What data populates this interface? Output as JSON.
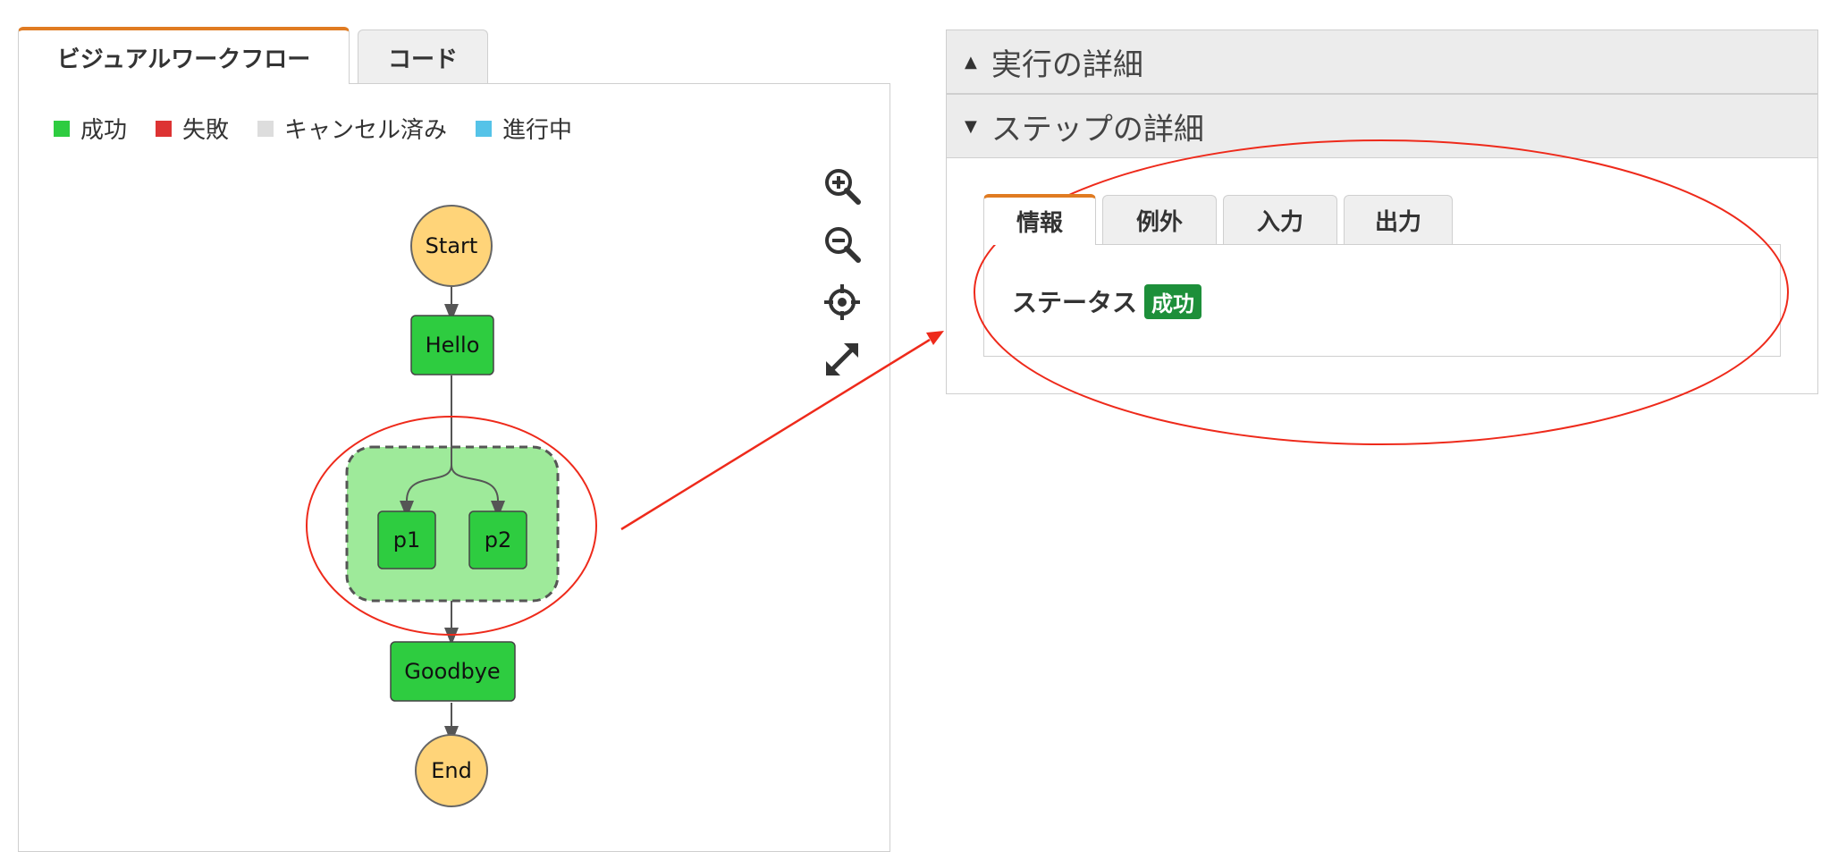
{
  "left_tabs": [
    {
      "label": "ビジュアルワークフロー"
    },
    {
      "label": "コード"
    }
  ],
  "legend": [
    {
      "label": "成功",
      "color": "#2ecc40"
    },
    {
      "label": "失敗",
      "color": "#dd3333"
    },
    {
      "label": "キャンセル済み",
      "color": "#dddddd"
    },
    {
      "label": "進行中",
      "color": "#55c3e8"
    }
  ],
  "zoom_controls": [
    "zoom-in-icon",
    "zoom-out-icon",
    "center-icon",
    "fullscreen-icon"
  ],
  "workflow": {
    "start": "Start",
    "hello": "Hello",
    "p1": "p1",
    "p2": "p2",
    "goodbye": "Goodbye",
    "end": "End"
  },
  "colors": {
    "success": "#2ecc40",
    "start_end": "#ffd479",
    "parallel_bg": "#9eea9a",
    "tab_accent": "#e07b22",
    "annotation": "#ee2a1b"
  },
  "right_panel": {
    "execution_details": "実行の詳細",
    "step_details": "ステップの詳細",
    "step_tabs": [
      {
        "label": "情報"
      },
      {
        "label": "例外"
      },
      {
        "label": "入力"
      },
      {
        "label": "出力"
      }
    ],
    "status_label": "ステータス",
    "status_value": "成功"
  }
}
